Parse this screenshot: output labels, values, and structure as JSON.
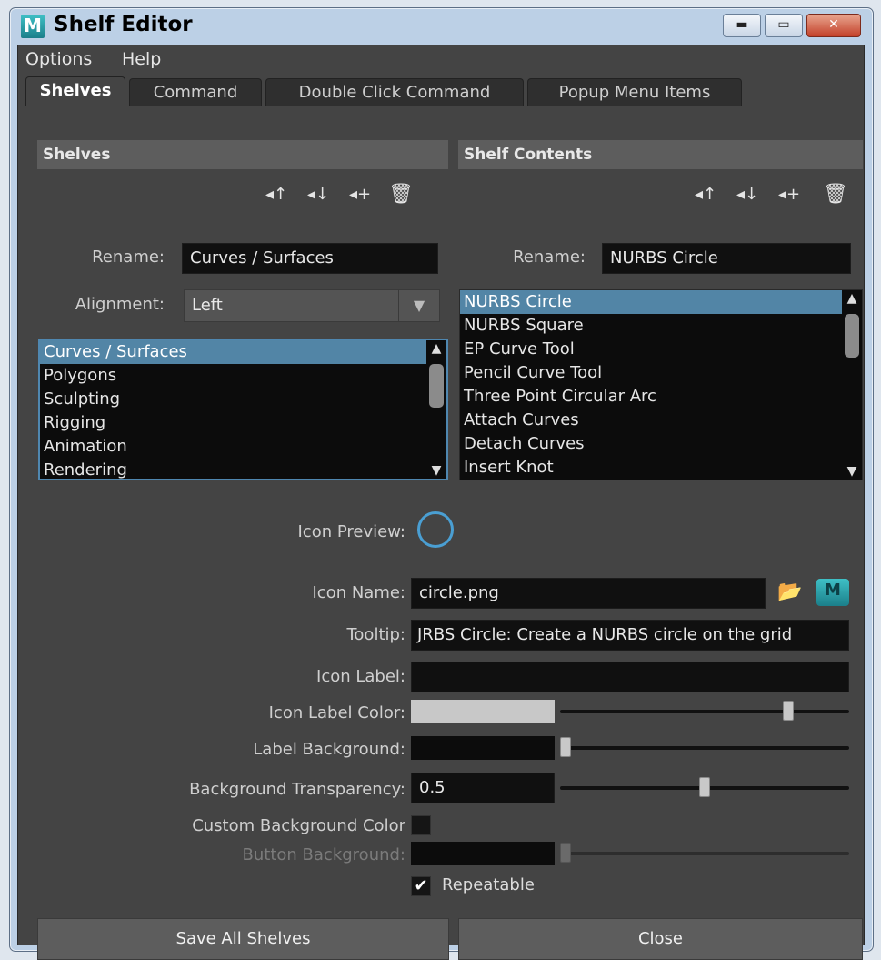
{
  "window": {
    "title": "Shelf Editor",
    "logo_letter": "M",
    "controls": {
      "minimize": "▬",
      "maximize": "▭",
      "close": "✕"
    }
  },
  "menu": [
    "Options",
    "Help"
  ],
  "tabs": [
    {
      "label": "Shelves",
      "active": true
    },
    {
      "label": "Command",
      "active": false
    },
    {
      "label": "Double Click Command",
      "active": false
    },
    {
      "label": "Popup Menu Items",
      "active": false
    }
  ],
  "shelves": {
    "header": "Shelves",
    "rename_label": "Rename:",
    "rename_value": "Curves / Surfaces",
    "alignment_label": "Alignment:",
    "alignment_value": "Left",
    "items": [
      "Curves / Surfaces",
      "Polygons",
      "Sculpting",
      "Rigging",
      "Animation",
      "Rendering"
    ],
    "selected_index": 0
  },
  "shelf_contents": {
    "header": "Shelf Contents",
    "rename_label": "Rename:",
    "rename_value": "NURBS Circle",
    "items": [
      "NURBS Circle",
      "NURBS Square",
      "EP Curve Tool",
      "Pencil Curve Tool",
      "Three Point Circular Arc",
      "Attach Curves",
      "Detach Curves",
      "Insert Knot"
    ],
    "selected_index": 0
  },
  "icons": {
    "move_up": "arrow-up-icon",
    "move_down": "arrow-down-icon",
    "add": "add-icon",
    "delete": "trash-icon",
    "folder": "folder-icon",
    "maya": "maya-icon"
  },
  "properties": {
    "icon_preview_label": "Icon Preview:",
    "icon_name_label": "Icon Name:",
    "icon_name_value": "circle.png",
    "tooltip_label": "Tooltip:",
    "tooltip_value": "JRBS Circle: Create a NURBS circle on the grid",
    "icon_label_label": "Icon Label:",
    "icon_label_value": "",
    "icon_label_color_label": "Icon Label Color:",
    "icon_label_color": "#c8c8c8",
    "icon_label_color_level": 0.8,
    "label_background_label": "Label Background:",
    "label_background_color": "#0c0c0c",
    "label_background_level": 0.0,
    "background_transparency_label": "Background Transparency:",
    "background_transparency_value": "0.5",
    "background_transparency_level": 0.5,
    "custom_background_label": "Custom Background Color",
    "button_background_label": "Button Background:",
    "button_background_level": 0.0,
    "repeatable_label": "Repeatable",
    "repeatable_checked": true
  },
  "buttons": {
    "save": "Save All Shelves",
    "close": "Close"
  }
}
